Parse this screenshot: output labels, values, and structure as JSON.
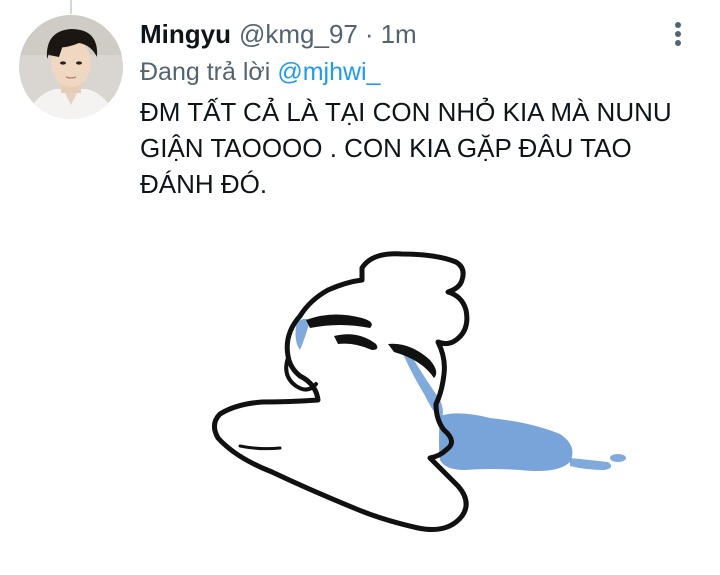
{
  "tweet": {
    "author_name": "Mingyu",
    "author_handle": "@kmg_97",
    "separator": "·",
    "time": "1m",
    "replying_label": "Đang trả lời",
    "replying_to": "@mjhwi_",
    "text": "ĐM TẤT CẢ LÀ TẠI CON NHỎ KIA MÀ NUNU\nGIẬN TAOOOO . CON KIA GẶP ĐÂU TAO\nĐÁNH ĐÓ.",
    "more_icon": "more-vertical-icon",
    "avatar_icon": "avatar",
    "image": {
      "subject": "crying-melted-blob-drawing",
      "tear_color": "#6a9ad6",
      "line_color": "#111111"
    }
  },
  "colors": {
    "primary_text": "#0f1419",
    "secondary_text": "#536471",
    "link": "#1d9bf0",
    "background": "#ffffff"
  }
}
